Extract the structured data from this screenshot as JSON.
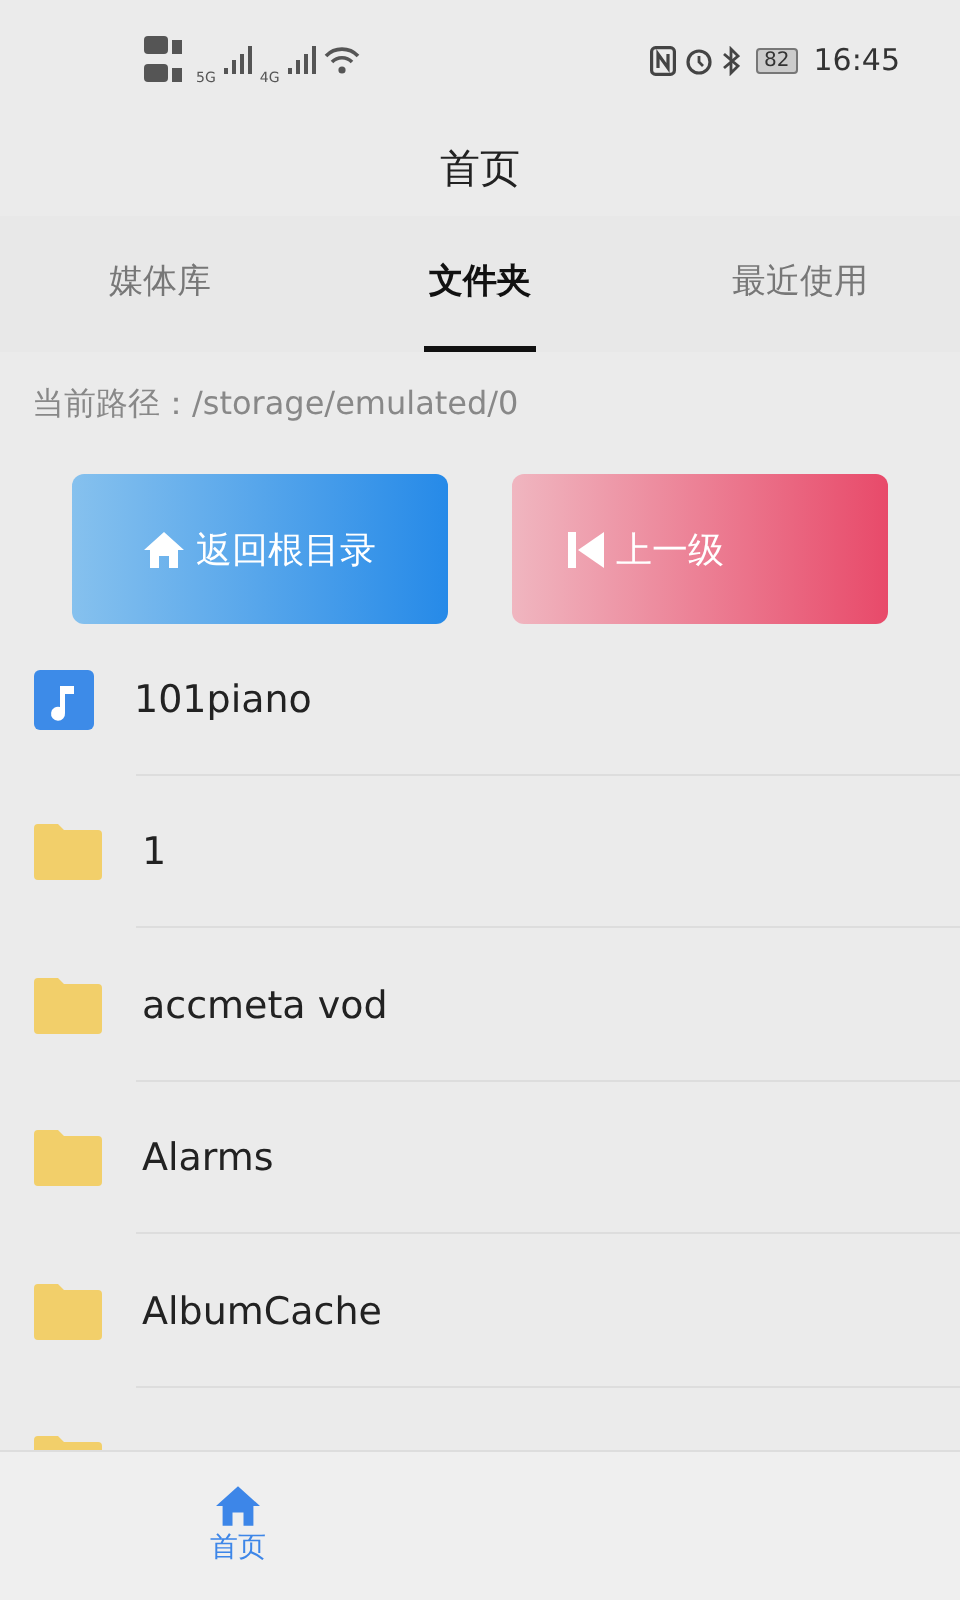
{
  "status_bar": {
    "battery": "82",
    "time": "16:45",
    "network_labels": [
      "5G",
      "4G"
    ]
  },
  "title": "首页",
  "tabs": [
    {
      "label": "媒体库",
      "selected": false
    },
    {
      "label": "文件夹",
      "selected": true
    },
    {
      "label": "最近使用",
      "selected": false
    }
  ],
  "path": "当前路径：/storage/emulated/0",
  "buttons": [
    {
      "label": "返回根目录",
      "kind": "home"
    },
    {
      "label": "上一级",
      "kind": "up"
    }
  ],
  "files": [
    {
      "kind": "audio",
      "name": "101piano"
    },
    {
      "kind": "folder",
      "name": "1"
    },
    {
      "kind": "folder",
      "name": "accmeta vod"
    },
    {
      "kind": "folder",
      "name": "Alarms"
    },
    {
      "kind": "folder",
      "name": "AlbumCache"
    },
    {
      "kind": "folder"
    }
  ],
  "bottom_nav": [
    {
      "label": "首页",
      "selected": true
    }
  ]
}
